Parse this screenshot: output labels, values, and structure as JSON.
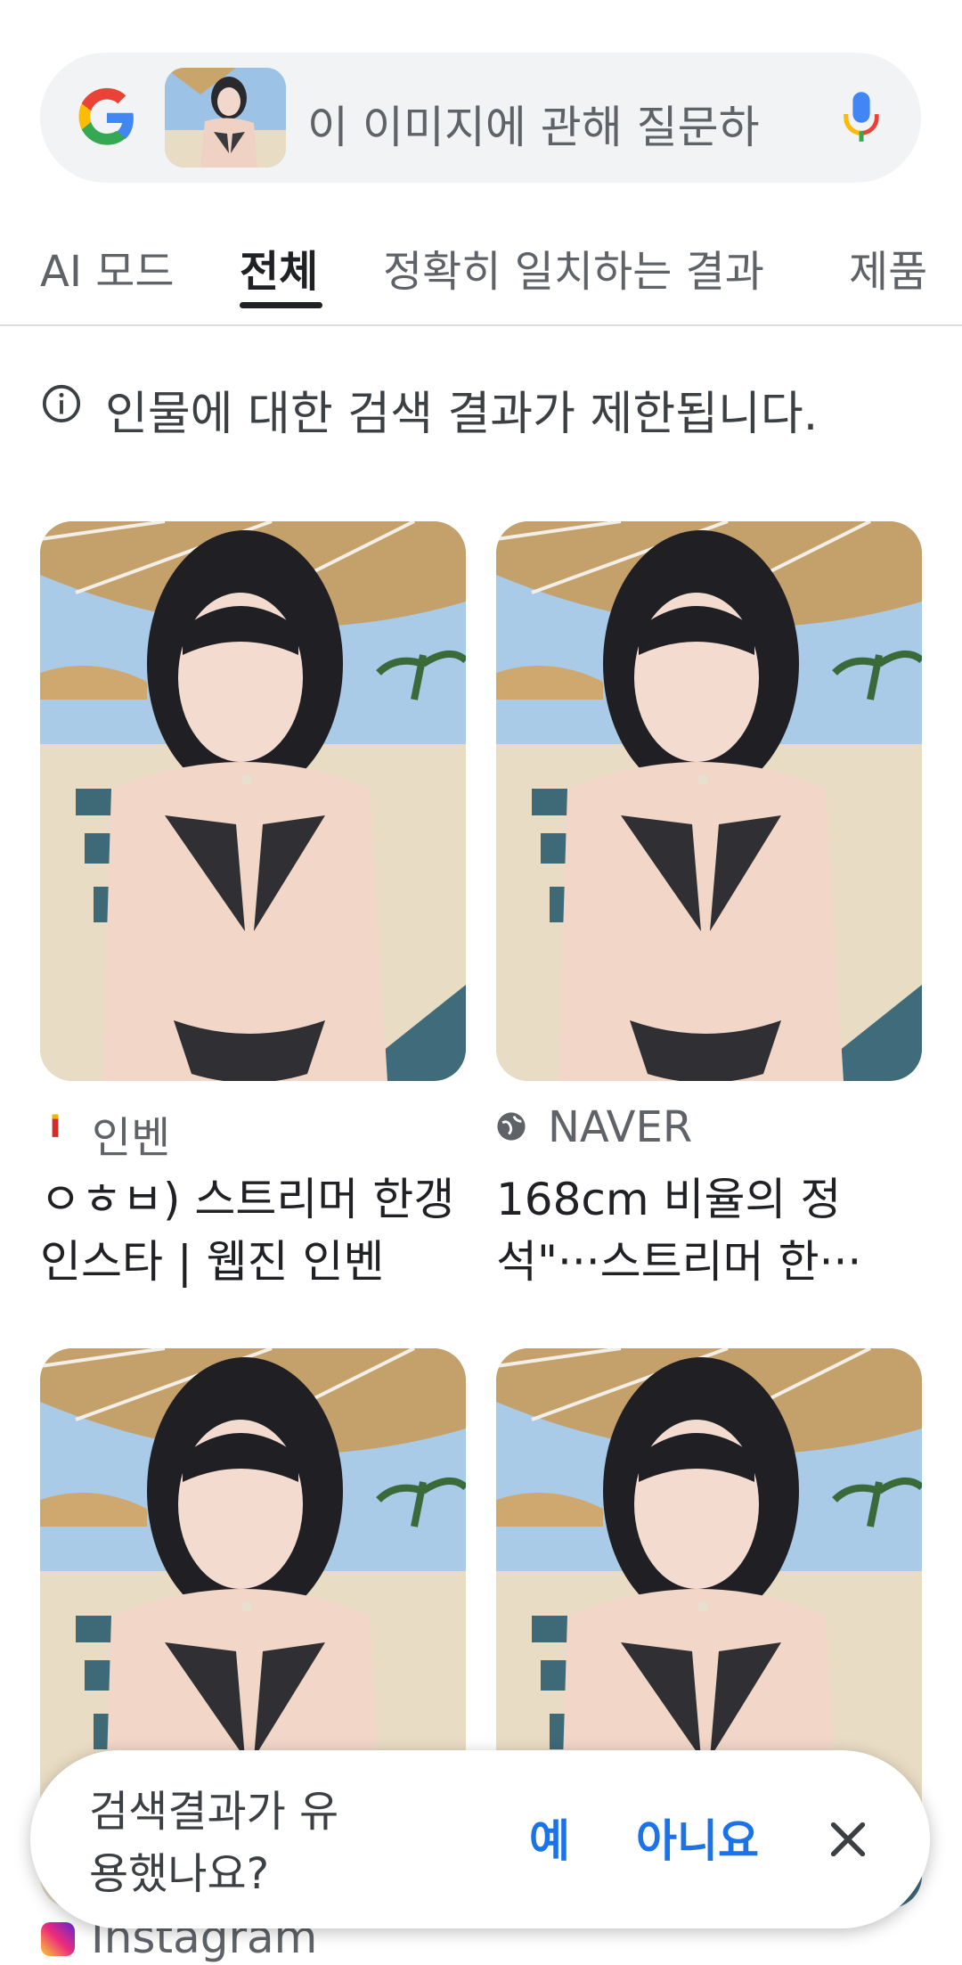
{
  "search": {
    "placeholder": "이 이미지에 관해 질문하",
    "logo_icon": "google-g-logo",
    "mic_icon": "microphone-icon"
  },
  "tabs": [
    {
      "label": "AI 모드"
    },
    {
      "label": "전체"
    },
    {
      "label": "정확히 일치하는 결과"
    },
    {
      "label": "제품"
    }
  ],
  "notice": {
    "text": "인물에 대한 검색 결과가 제한됩니다.",
    "icon": "info-icon"
  },
  "results": [
    {
      "source": "인벤",
      "title": "ㅇㅎㅂ) 스트리머 한갱 인스타 | 웹진 인벤"
    },
    {
      "source": "NAVER",
      "title": "168cm 비율의 정석\"···스트리머 한···"
    },
    {
      "source": "Instagram",
      "title": ""
    },
    {
      "source": "",
      "title": ""
    }
  ],
  "feedback": {
    "question": "검색결과가 유용했나요?",
    "yes": "예",
    "no": "아니요"
  },
  "colors": {
    "accent": "#1a73e8",
    "search_bg": "#f1f3f4"
  }
}
